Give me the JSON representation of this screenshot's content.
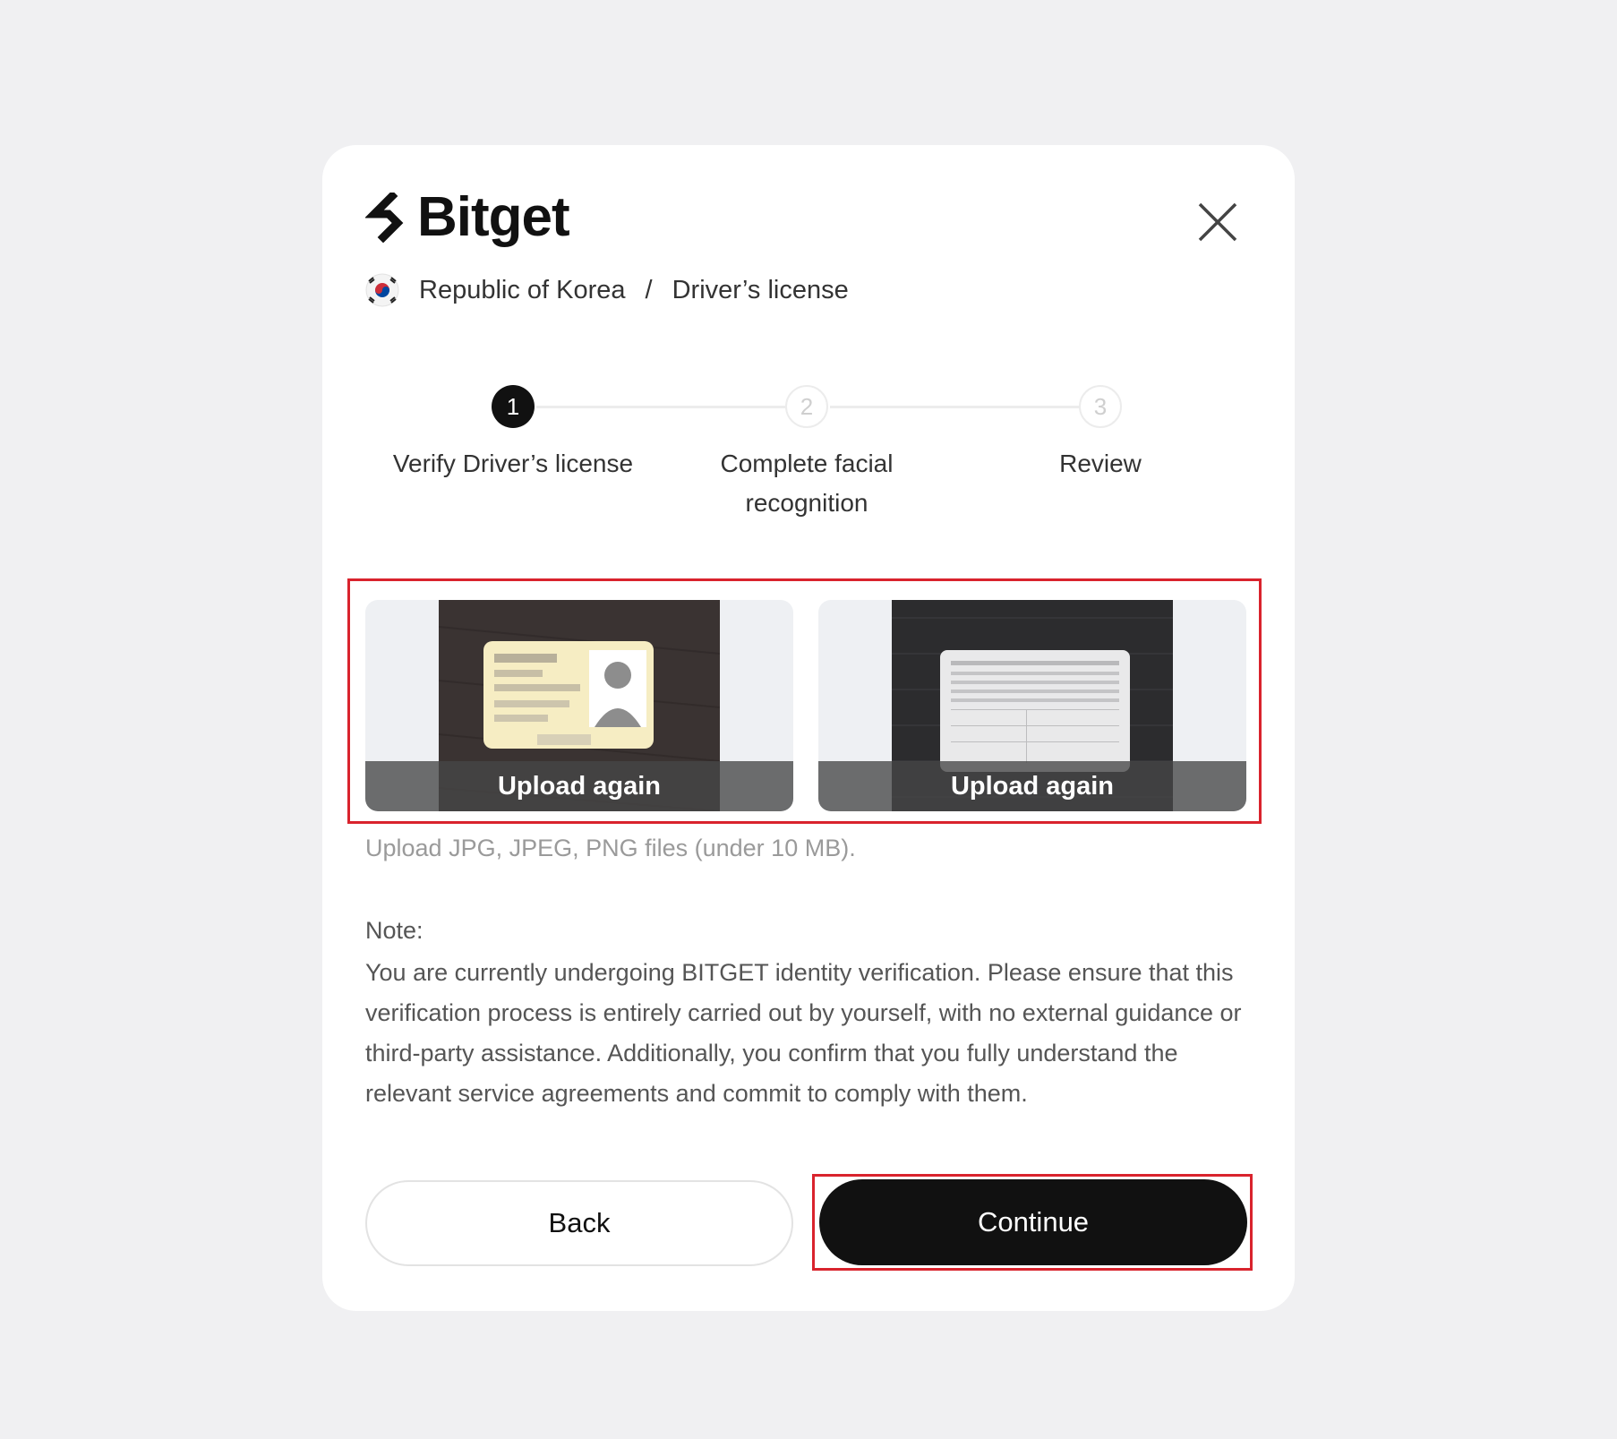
{
  "brand": {
    "name": "Bitget"
  },
  "breadcrumb": {
    "country": "Republic of Korea",
    "separator": "/",
    "document": "Driver’s license"
  },
  "steps": [
    {
      "number": "1",
      "label": "Verify Driver’s license",
      "state": "active"
    },
    {
      "number": "2",
      "label": "Complete facial recognition",
      "state": "pending"
    },
    {
      "number": "3",
      "label": "Review",
      "state": "pending"
    }
  ],
  "uploads": {
    "front": {
      "action_label": "Upload again"
    },
    "back": {
      "action_label": "Upload again"
    },
    "hint": "Upload JPG, JPEG, PNG files (under 10 MB)."
  },
  "note": {
    "title": "Note:",
    "body": "You are currently undergoing BITGET identity verification. Please ensure that this verification process is entirely carried out by yourself, with no external guidance or third-party assistance. Additionally, you confirm that you fully understand the relevant service agreements and commit to comply with them."
  },
  "actions": {
    "back_label": "Back",
    "continue_label": "Continue"
  },
  "colors": {
    "primary": "#111111",
    "highlight": "#d9232d",
    "background": "#f0f0f2",
    "card": "#ffffff"
  }
}
